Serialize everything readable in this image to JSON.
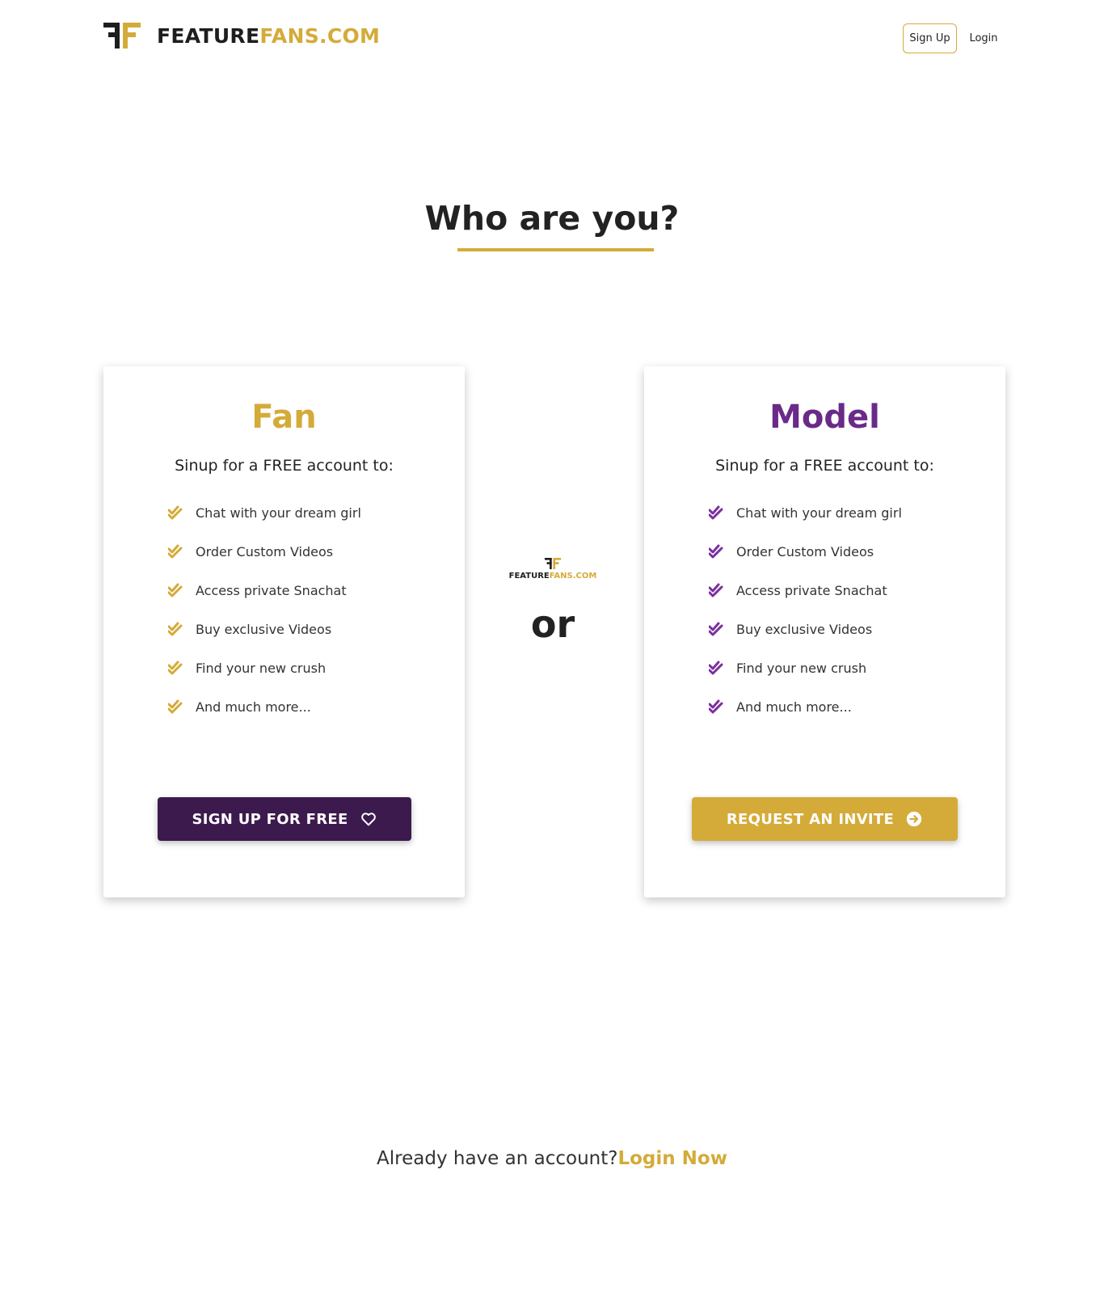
{
  "brand": {
    "name_dark": "FEATURE",
    "name_gold": "FANS.COM",
    "accent_color": "#d4ab39",
    "purple_color": "#6a2a88",
    "dark_purple_color": "#3d1a4d"
  },
  "header": {
    "signup_label": "Sign Up",
    "login_label": "Login"
  },
  "main": {
    "title": "Who are you?",
    "or_label": "or"
  },
  "fan_card": {
    "title": "Fan",
    "subtitle": "Sinup for a FREE account to:",
    "features": [
      "Chat with your dream girl",
      "Order Custom Videos",
      "Access private Snachat",
      "Buy exclusive Videos",
      "Find your new crush",
      "And much more..."
    ],
    "button_label": "SIGN UP FOR FREE",
    "button_icon": "heart-icon"
  },
  "model_card": {
    "title": "Model",
    "subtitle": "Sinup for a FREE account to:",
    "features": [
      "Chat with your dream girl",
      "Order Custom Videos",
      "Access private Snachat",
      "Buy exclusive Videos",
      "Find your new crush",
      "And much more..."
    ],
    "button_label": "REQUEST AN INVITE",
    "button_icon": "arrow-circle-right-icon"
  },
  "footer": {
    "question": "Already have an account?",
    "link_label": "Login Now"
  }
}
